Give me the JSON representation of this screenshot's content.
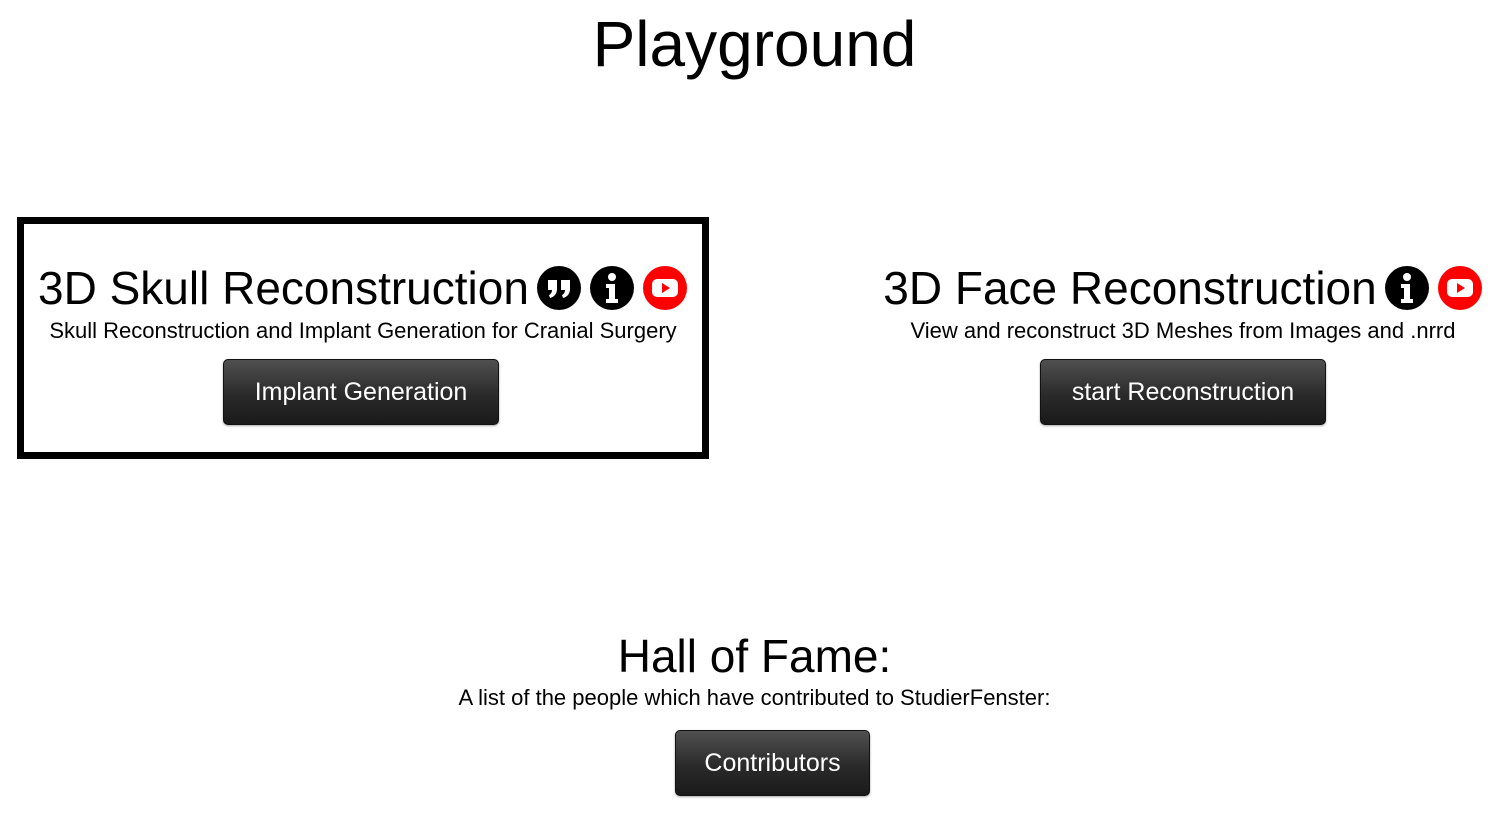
{
  "page": {
    "title": "Playground"
  },
  "cards": {
    "skull": {
      "title": "3D Skull Reconstruction",
      "description": "Skull Reconstruction and Implant Generation for Cranial Surgery",
      "button_label": "Implant Generation",
      "selected": true,
      "icons": [
        "quote-icon",
        "info-icon",
        "youtube-icon"
      ]
    },
    "face": {
      "title": "3D Face Reconstruction",
      "description": "View and reconstruct 3D Meshes from Images and .nrrd",
      "button_label": "start Reconstruction",
      "icons": [
        "info-icon",
        "youtube-icon"
      ]
    }
  },
  "hall_of_fame": {
    "title": "Hall of Fame:",
    "description": "A list of the people which have contributed to StudierFenster:",
    "button_label": "Contributors"
  },
  "colors": {
    "youtube_red": "#ff0000",
    "button_dark": "#2a2a2a",
    "icon_black": "#000000"
  }
}
